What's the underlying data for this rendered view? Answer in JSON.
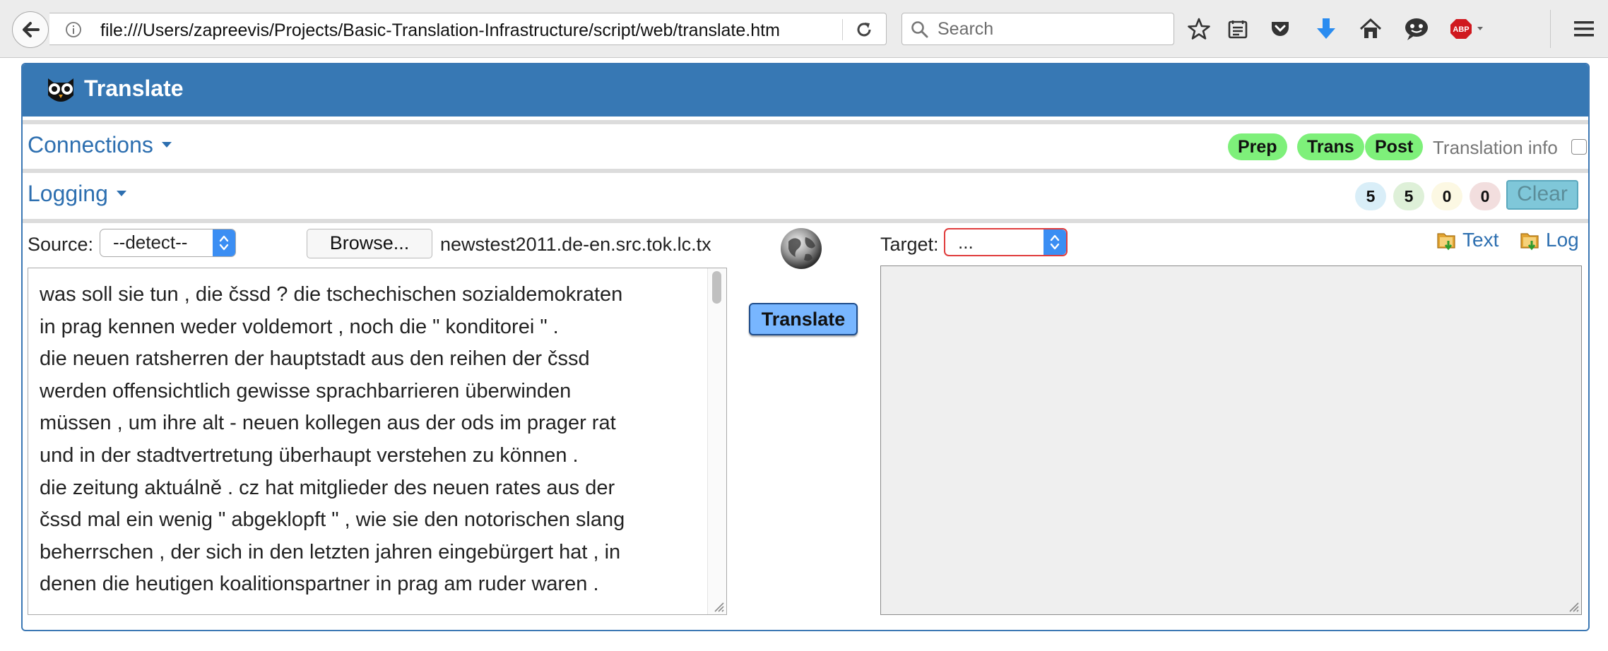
{
  "browser": {
    "url": "file:///Users/zapreevis/Projects/Basic-Translation-Infrastructure/script/web/translate.htm",
    "search_placeholder": "Search",
    "toolbar_icons": [
      "star-icon",
      "reading-list-icon",
      "pocket-icon",
      "download-icon",
      "home-icon",
      "chat-icon",
      "adblock-icon",
      "menu-icon"
    ],
    "adblock_label": "ABP"
  },
  "app": {
    "title": "Translate",
    "header_color": "#3778b4"
  },
  "connections": {
    "label": "Connections",
    "pills": [
      "Prep",
      "Trans",
      "Post"
    ],
    "pill_color": "#7ef07a",
    "translation_info_label": "Translation info",
    "translation_info_checked": false
  },
  "logging": {
    "label": "Logging",
    "counts": [
      {
        "value": "5",
        "color": "#d9eef8"
      },
      {
        "value": "5",
        "color": "#def0d8"
      },
      {
        "value": "0",
        "color": "#fcf8e3"
      },
      {
        "value": "0",
        "color": "#f2dede"
      }
    ],
    "clear_label": "Clear"
  },
  "source": {
    "label": "Source:",
    "selected": "--detect--",
    "browse_label": "Browse...",
    "file_name": "newstest2011.de-en.src.tok.lc.tx",
    "text": "was soll sie tun , die čssd ? die tschechischen sozialdemokraten\nin prag kennen weder voldemort , noch die \" konditorei \" .\ndie neuen ratsherren der hauptstadt aus den reihen der čssd\nwerden offensichtlich gewisse sprachbarrieren überwinden\nmüssen , um ihre alt - neuen kollegen aus der ods im prager rat\nund in der stadtvertretung überhaupt verstehen zu können .\ndie zeitung aktuálně . cz hat mitglieder des neuen rates aus der\nčssd mal ein wenig \" abgeklopft \" , wie sie den notorischen slang\nbeherrschen , der sich in den letzten jahren eingebürgert hat , in\ndenen die heutigen koalitionspartner in prag am ruder waren ."
  },
  "translate_button": "Translate",
  "target": {
    "label": "Target:",
    "selected": "...",
    "text_link": "Text",
    "log_link": "Log",
    "text": ""
  }
}
